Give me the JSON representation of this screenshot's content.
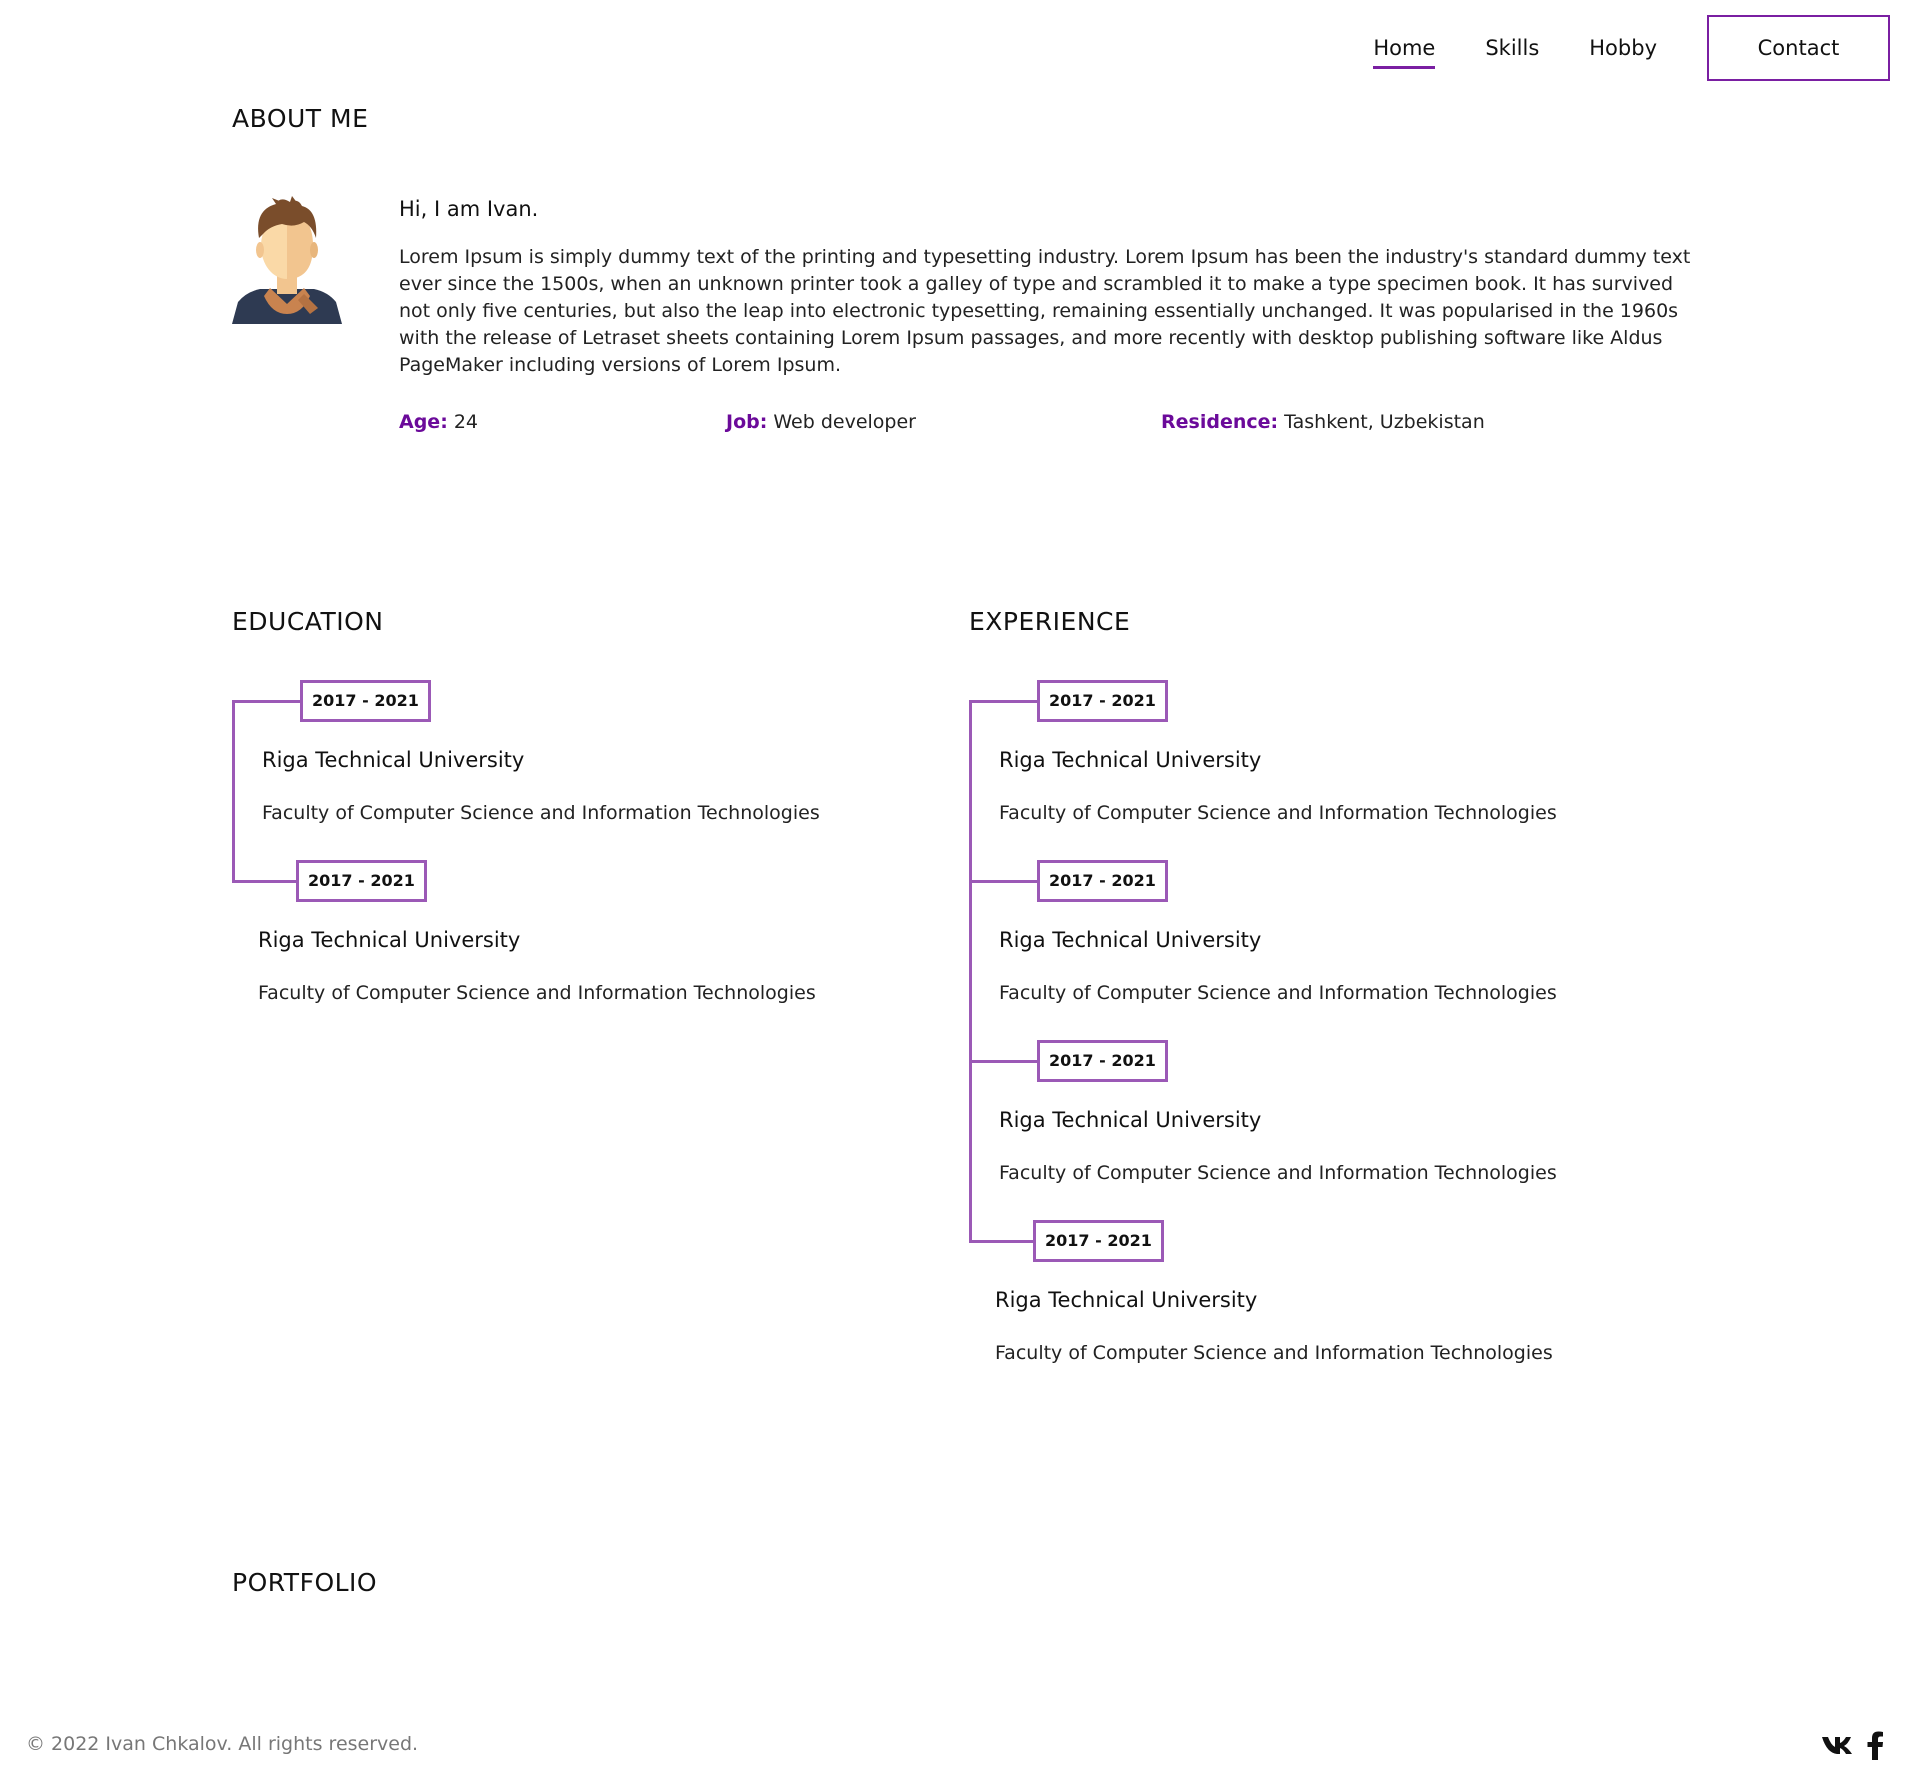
{
  "nav": {
    "links": [
      {
        "label": "Home",
        "active": true
      },
      {
        "label": "Skills",
        "active": false
      },
      {
        "label": "Hobby",
        "active": false
      }
    ],
    "contact_label": "Contact"
  },
  "about": {
    "title": "ABOUT ME",
    "greeting": "Hi, I am Ivan.",
    "bio": "Lorem Ipsum is simply dummy text of the printing and typesetting industry. Lorem Ipsum has been the industry's standard dummy text ever since the 1500s, when an unknown printer took a galley of type and scrambled it to make a type specimen book. It has survived not only five centuries, but also the leap into electronic typesetting, remaining essentially unchanged. It was popularised in the 1960s with the release of Letraset sheets containing Lorem Ipsum passages, and more recently with desktop publishing software like Aldus PageMaker including versions of Lorem Ipsum.",
    "facts": [
      {
        "key": "Age:",
        "value": "24"
      },
      {
        "key": "Job:",
        "value": "Web developer"
      },
      {
        "key": "Residence:",
        "value": "Tashkent, Uzbekistan"
      }
    ]
  },
  "education": {
    "title": "EDUCATION",
    "items": [
      {
        "years": "2017 - 2021",
        "school": "Riga Technical University",
        "faculty": "Faculty of Computer Science and Information Technologies"
      },
      {
        "years": "2017 - 2021",
        "school": "Riga Technical University",
        "faculty": "Faculty of Computer Science and Information Technologies"
      }
    ]
  },
  "experience": {
    "title": "EXPERIENCE",
    "items": [
      {
        "years": "2017 - 2021",
        "school": "Riga Technical University",
        "faculty": "Faculty of Computer Science and Information Technologies"
      },
      {
        "years": "2017 - 2021",
        "school": "Riga Technical University",
        "faculty": "Faculty of Computer Science and Information Technologies"
      },
      {
        "years": "2017 - 2021",
        "school": "Riga Technical University",
        "faculty": "Faculty of Computer Science and Information Technologies"
      },
      {
        "years": "2017 - 2021",
        "school": "Riga Technical University",
        "faculty": "Faculty of Computer Science and Information Technologies"
      }
    ]
  },
  "portfolio": {
    "title": "PORTFOLIO"
  },
  "footer": {
    "copyright": "© 2022 Ivan Chkalov. All rights reserved.",
    "social": [
      "vk-icon",
      "facebook-icon"
    ]
  },
  "colors": {
    "accent": "#7a1fa2",
    "underline": "#c25ae6",
    "timeline": "#9b59b6"
  }
}
